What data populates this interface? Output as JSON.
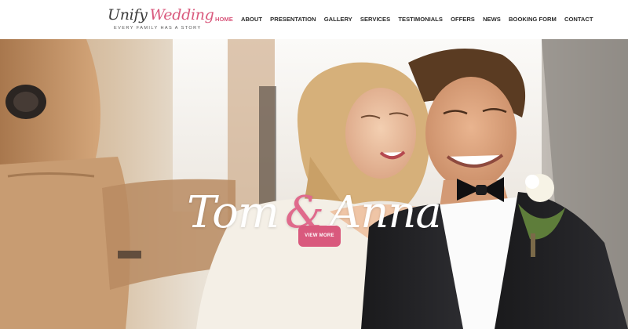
{
  "brand": {
    "name_first": "Unify",
    "name_second": "Wedding",
    "tagline": "EVERY FAMILY HAS A STORY",
    "accent_color": "#d9597d"
  },
  "nav": {
    "items": [
      {
        "label": "HOME",
        "active": true
      },
      {
        "label": "ABOUT",
        "active": false
      },
      {
        "label": "PRESENTATION",
        "active": false
      },
      {
        "label": "GALLERY",
        "active": false
      },
      {
        "label": "SERVICES",
        "active": false
      },
      {
        "label": "TESTIMONIALS",
        "active": false
      },
      {
        "label": "OFFERS",
        "active": false
      },
      {
        "label": "NEWS",
        "active": false
      },
      {
        "label": "BOOKING FORM",
        "active": false
      },
      {
        "label": "CONTACT",
        "active": false
      }
    ]
  },
  "hero": {
    "name_one": "Tom",
    "ampersand": "&",
    "name_two": "Anna",
    "button_label": "VIEW MORE",
    "image_subject": "couple-in-car-photo"
  }
}
